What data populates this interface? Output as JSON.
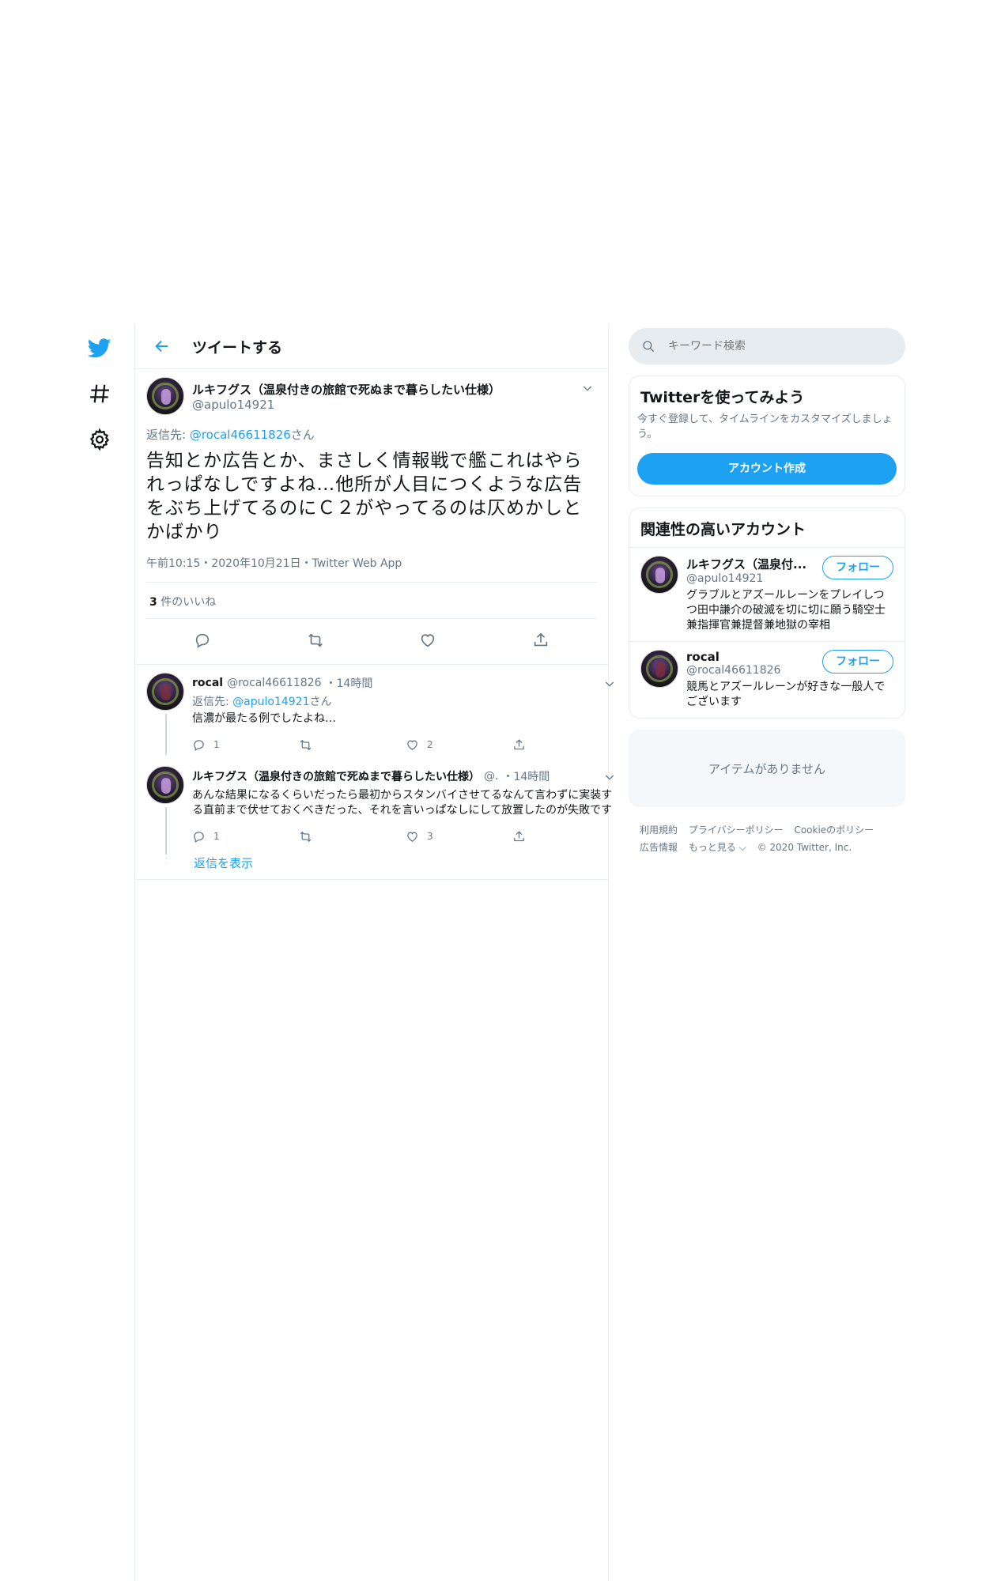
{
  "nav": {
    "icons": [
      "twitter-logo-icon",
      "hashtag-icon",
      "settings-gear-icon"
    ]
  },
  "header": {
    "title": "ツイートする"
  },
  "focus_tweet": {
    "display_name": "ルキフグス（温泉付きの旅館で死ぬまで暮らしたい仕様）",
    "handle": "@apulo14921",
    "reply_prefix": "返信先: ",
    "reply_handle": "@rocal46611826",
    "reply_suffix": "さん",
    "text": "告知とか広告とか、まさしく情報戦で艦これはやられっぱなしですよね…他所が人目につくような広告をぶち上げてるのにＣ２がやってるのは仄めかしとかばかり",
    "meta": "午前10:15・2020年10月21日・Twitter Web App",
    "likes_count": "3",
    "likes_label": " 件のいいね"
  },
  "replies": [
    {
      "display_name": "rocal",
      "handle": "@rocal46611826",
      "time": "・14時間",
      "reply_prefix": "返信先: ",
      "reply_handle": "@apulo14921",
      "reply_suffix": "さん",
      "text": "信濃が最たる例でしたよね…",
      "reply_count": "1",
      "retweet_count": "",
      "like_count": "2"
    },
    {
      "display_name": "ルキフグス（温泉付きの旅館で死ぬまで暮らしたい仕様）",
      "handle": "@.",
      "time": "・14時間",
      "text": "あんな結果になるくらいだったら最初からスタンバイさせてるなんて言わずに実装する直前まで伏せておくべきだった、それを言いっぱなしにして放置したのが失敗です",
      "reply_count": "1",
      "retweet_count": "",
      "like_count": "3"
    }
  ],
  "show_replies": "返信を表示",
  "sidebar": {
    "search_placeholder": "キーワード検索",
    "signup_card": {
      "title": "Twitterを使ってみよう",
      "subtitle": "今すぐ登録して、タイムラインをカスタマイズしましょう。",
      "button": "アカウント作成"
    },
    "related": {
      "title": "関連性の高いアカウント",
      "accounts": [
        {
          "name": "ルキフグス（温泉付...",
          "handle": "@apulo14921",
          "follow": "フォロー",
          "bio": "グラブルとアズールレーンをプレイしつつ田中謙介の破滅を切に切に願う騎空士兼指揮官兼提督兼地獄の宰相"
        },
        {
          "name": "rocal",
          "handle": "@rocal46611826",
          "follow": "フォロー",
          "bio": "競馬とアズールレーンが好きな一般人でございます"
        }
      ]
    },
    "empty_text": "アイテムがありません",
    "footer": {
      "terms": "利用規約",
      "privacy": "プライバシーポリシー",
      "cookies": "Cookieのポリシー",
      "ads": "広告情報",
      "more": "もっと見る ⌵",
      "copyright": "© 2020 Twitter, Inc."
    }
  },
  "colors": {
    "accent": "#1da1f2",
    "muted": "#657786",
    "border": "#e6ecf0"
  }
}
